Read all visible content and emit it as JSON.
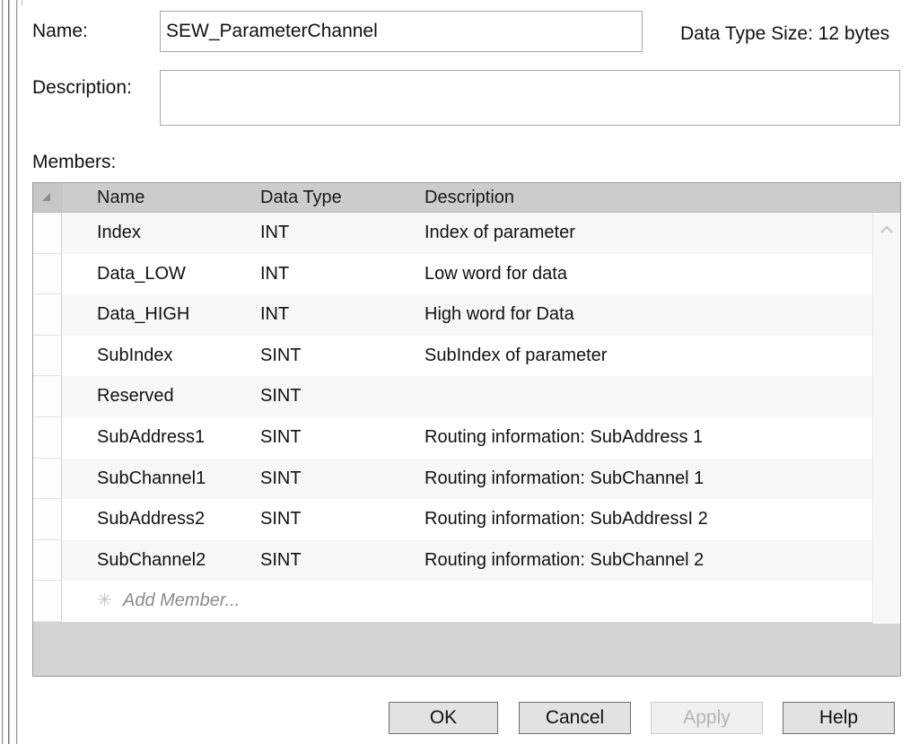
{
  "form": {
    "name_label": "Name:",
    "name_value": "SEW_ParameterChannel",
    "name_placeholder": "",
    "description_label": "Description:",
    "description_value": "",
    "description_placeholder": "",
    "datatype_size_text": "Data Type Size:  12 bytes",
    "members_label": "Members:"
  },
  "grid": {
    "columns": [
      "Name",
      "Data Type",
      "Description"
    ],
    "rows": [
      {
        "name": "Index",
        "type": "INT",
        "description": "Index of parameter"
      },
      {
        "name": "Data_LOW",
        "type": "INT",
        "description": "Low word for data"
      },
      {
        "name": "Data_HIGH",
        "type": "INT",
        "description": "High word for Data"
      },
      {
        "name": "SubIndex",
        "type": "SINT",
        "description": "SubIndex of parameter"
      },
      {
        "name": "Reserved",
        "type": "SINT",
        "description": ""
      },
      {
        "name": "SubAddress1",
        "type": "SINT",
        "description": "Routing information: SubAddress 1"
      },
      {
        "name": "SubChannel1",
        "type": "SINT",
        "description": "Routing information: SubChannel 1"
      },
      {
        "name": "SubAddress2",
        "type": "SINT",
        "description": "Routing information: SubAddressI 2"
      },
      {
        "name": "SubChannel2",
        "type": "SINT",
        "description": "Routing information: SubChannel 2"
      }
    ],
    "add_member_text": "Add Member...",
    "add_member_glyph": "✳",
    "scrollbar": {
      "up_icon": "chevron-up-icon",
      "down_icon": "chevron-down-icon"
    },
    "header_corner_icon": "select-all-corner-icon"
  },
  "footer": {
    "ok_label": "OK",
    "cancel_label": "Cancel",
    "apply_label": "Apply",
    "apply_enabled": false,
    "help_label": "Help"
  },
  "colors": {
    "header_bg": "#cccccc",
    "row_alt_bg": "#f7f7f7",
    "filler_bg": "#d4d4d4",
    "button_bg": "#e2e2e2",
    "disabled_text": "#b4b4b4"
  }
}
